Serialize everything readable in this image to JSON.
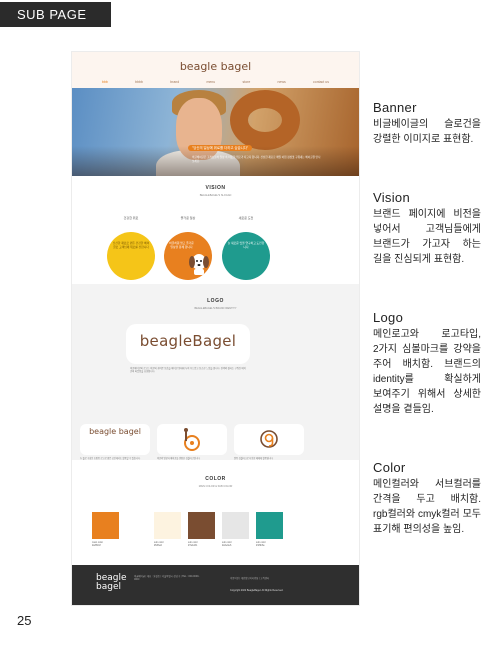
{
  "page": {
    "tag": "SUB PAGE",
    "page_number": "25"
  },
  "mockup": {
    "brand": "beagle bagel",
    "nav": [
      "bbb",
      "bbbb",
      "brand",
      "menu",
      "store",
      "news",
      "contact us"
    ],
    "banner": {
      "headline": "\"당신의 일상에 위로를 더하고 싶습니다\"",
      "body": "비글베이글은 고객님들의 일상 속 따뜻한 위로가 되고자 합니다. 신선한 재료로 매일 아침 정성껏 구워내는 베이글을 만나보세요."
    },
    "vision": {
      "title": "VISION",
      "subtitle": "BEAGLEBAGEL'S SLOGAN",
      "circles": [
        {
          "label": "건강한 위로",
          "text": "신선한 재료로 만든 건강한 베이글로 고객님께 위로를 전합니다",
          "color": "#f5c518"
        },
        {
          "label": "즐거운 일상",
          "text": "비글처럼 밝고 즐거운 일상을 함께 합니다",
          "color": "#e8801f"
        },
        {
          "label": "새로운 도전",
          "text": "늘 새로운 맛을 연구하고 도전합니다",
          "color": "#1f9b8e"
        }
      ]
    },
    "logo": {
      "title": "LOGO",
      "subtitle": "BEAGLEBAGEL'S BRAND IDENTITY",
      "wordmark": "beagleBagel",
      "description": "비글베이글의 로고는 비글의 귀여운 모습을 베이글 형태에 녹여 부드럽고 친근한 느낌을 줍니다. 갈색의 컬러는 구워진 베이글의 따뜻함을 표현합니다.",
      "cards": [
        {
          "word": "beagle bagel",
          "desc": "두 줄로 구성된 조합형 로고로 좁은 공간에서도 활용할 수 있습니다."
        },
        {
          "word": "b",
          "desc": "비글의 얼굴과 베이글을 결합한 심볼마크입니다."
        },
        {
          "word": "bg",
          "desc": "원형 심볼마크로 다양한 매체에 활용됩니다."
        }
      ]
    },
    "color": {
      "title": "COLOR",
      "subtitle": "MAIN COLOR & SUB COLOR",
      "swatches": [
        {
          "name": "main color",
          "hex": "#e8801f"
        },
        {
          "name": "sub color",
          "hex": "#fdf3e0"
        },
        {
          "name": "sub color",
          "hex": "#7a4d31"
        },
        {
          "name": "sub color",
          "hex": "#e6e6e6"
        },
        {
          "name": "sub color",
          "hex": "#1f9b8e"
        }
      ]
    },
    "footer": {
      "logo_line1": "beagle",
      "logo_line2": "bagel",
      "info": "비글베이글 | 대표 : 홍길동 | 서울특별시 강남구 | TEL : 000-0000-0000",
      "links": "이용약관 | 개인정보처리방침 | 고객센터",
      "copyright": "Copyright 2022 BeagleBagel. All Rights Reserved."
    }
  },
  "side_notes": [
    {
      "heading": "Banner",
      "text": "비글베이글의 슬로건을 강렬한 이미지로 표현함."
    },
    {
      "heading": "Vision",
      "text": "브랜드 페이지에 비전을 넣어서 고객님들에게 브랜드가 가고자 하는 길을 진심되게 표현함."
    },
    {
      "heading": "Logo",
      "text": "메인로고와 로고타입, 2가지 심볼마크를 강약을 주어 배치함. 브랜드의 identity를 확실하게 보여주기 위해서 상세한 설명을 곁들임."
    },
    {
      "heading": "Color",
      "text": "메인컬러와 서브컬러를 간격을 두고 배치함. rgb컬러와 cmyk컬러 모두 표기해 편의성을 높임."
    }
  ]
}
